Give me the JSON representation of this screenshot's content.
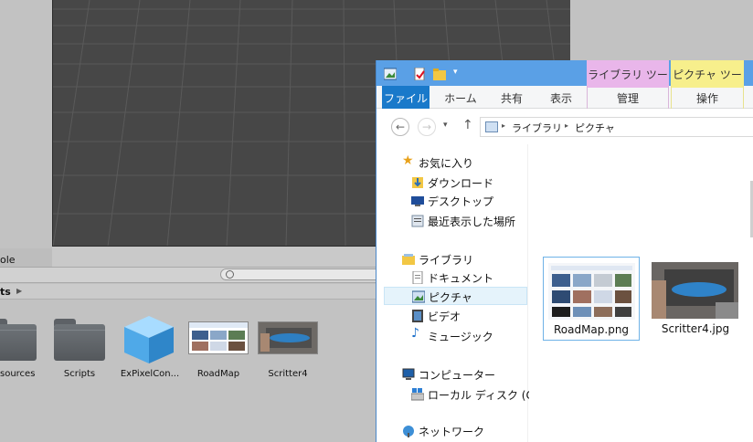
{
  "unity": {
    "console_tab": "ole",
    "breadcrumb": "ts",
    "assets": [
      {
        "label": "sources",
        "kind": "folder"
      },
      {
        "label": "Scripts",
        "kind": "folder"
      },
      {
        "label": "ExPixelCon...",
        "kind": "cube"
      },
      {
        "label": "RoadMap",
        "kind": "image"
      },
      {
        "label": "Scritter4",
        "kind": "image"
      }
    ]
  },
  "explorer": {
    "context_tabs": {
      "library": "ライブラリ ツール",
      "picture": "ピクチャ ツール"
    },
    "ribbon_tabs": [
      "ファイル",
      "ホーム",
      "共有",
      "表示",
      "管理",
      "操作"
    ],
    "address": {
      "part1": "ライブラリ",
      "part2": "ピクチャ",
      "sep": "▸"
    },
    "nav": {
      "favorites": "お気に入り",
      "downloads": "ダウンロード",
      "desktop": "デスクトップ",
      "recent": "最近表示した場所",
      "libraries": "ライブラリ",
      "documents": "ドキュメント",
      "pictures": "ピクチャ",
      "videos": "ビデオ",
      "music": "ミュージック",
      "computer": "コンピューター",
      "local_disk": "ローカル ディスク (C:)",
      "network": "ネットワーク"
    },
    "files": [
      {
        "name": "RoadMap.png",
        "selected": true
      },
      {
        "name": "Scritter4.jpg",
        "selected": false
      }
    ]
  },
  "colors": {
    "accent": "#1979ca",
    "titlebar": "#5aa0e6",
    "ctx_library": "#e9b6ea",
    "ctx_picture": "#f7ef8c"
  }
}
